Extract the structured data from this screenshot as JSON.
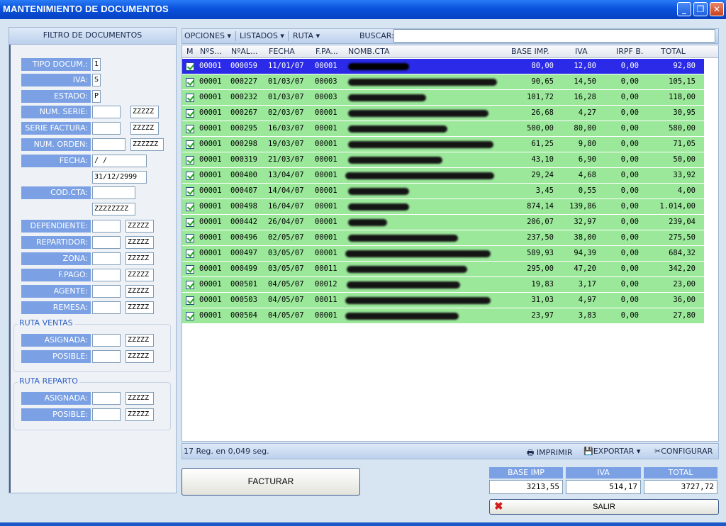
{
  "window": {
    "title": "MANTENIMIENTO DE DOCUMENTOS",
    "controls": {
      "minimize": "_",
      "maximize": "❐",
      "close": "✕"
    }
  },
  "filter": {
    "header": "FILTRO DE DOCUMENTOS",
    "fields": {
      "tipo_docum": {
        "label": "TIPO DOCUM.:",
        "value": "1"
      },
      "iva": {
        "label": "IVA:",
        "value": "S"
      },
      "estado": {
        "label": "ESTADO:",
        "value": "P"
      },
      "num_serie": {
        "label": "NUM. SERIE:",
        "from": "",
        "to": "ZZZZZ"
      },
      "serie_factura": {
        "label": "SERIE FACTURA:",
        "from": "",
        "to": "ZZZZZ"
      },
      "num_orden": {
        "label": "NUM. ORDEN:",
        "from": "",
        "to": "ZZZZZZ"
      },
      "fecha": {
        "label": "FECHA:",
        "from": " /  /",
        "to": "31/12/2999"
      },
      "cod_cta": {
        "label": "COD.CTA:",
        "from": "",
        "to": "ZZZZZZZZ"
      },
      "dependiente": {
        "label": "DEPENDIENTE:",
        "from": "",
        "to": "ZZZZZ"
      },
      "repartidor": {
        "label": "REPARTIDOR:",
        "from": "",
        "to": "ZZZZZ"
      },
      "zona": {
        "label": "ZONA:",
        "from": "",
        "to": "ZZZZZ"
      },
      "fpago": {
        "label": "F.PAGO:",
        "from": "",
        "to": "ZZZZZ"
      },
      "agente": {
        "label": "AGENTE:",
        "from": "",
        "to": "ZZZZZ"
      },
      "remesa": {
        "label": "REMESA:",
        "from": "",
        "to": "ZZZZZ"
      }
    },
    "ruta_ventas": {
      "title": "RUTA VENTAS",
      "asignada": {
        "label": "ASIGNADA:",
        "from": "",
        "to": "ZZZZZ"
      },
      "posible": {
        "label": "POSIBLE:",
        "from": "",
        "to": "ZZZZZ"
      }
    },
    "ruta_reparto": {
      "title": "RUTA REPARTO",
      "asignada": {
        "label": "ASIGNADA:",
        "from": "",
        "to": "ZZZZZ"
      },
      "posible": {
        "label": "POSIBLE:",
        "from": "",
        "to": "ZZZZZ"
      }
    }
  },
  "toolbar": {
    "opciones": "OPCIONES",
    "listados": "LISTADOS",
    "ruta": "RUTA",
    "buscar_label": "BUSCAR:",
    "buscar_value": "",
    "dropdown_arrow": "▾"
  },
  "grid": {
    "columns": [
      "M",
      "NºS...",
      "NºAL...",
      "FECHA",
      "F.PA...",
      "NOMB.CTA",
      "BASE IMP.",
      "IVA",
      "IRPF B.",
      "TOTAL"
    ],
    "rows": [
      {
        "serie": "00001",
        "num": "000059",
        "fecha": "11/01/07",
        "fpago": "00001",
        "base": "80,00",
        "iva": "12,80",
        "irpf": "0,00",
        "total": "92,80"
      },
      {
        "serie": "00001",
        "num": "000227",
        "fecha": "01/03/07",
        "fpago": "00003",
        "base": "90,65",
        "iva": "14,50",
        "irpf": "0,00",
        "total": "105,15"
      },
      {
        "serie": "00001",
        "num": "000232",
        "fecha": "01/03/07",
        "fpago": "00003",
        "base": "101,72",
        "iva": "16,28",
        "irpf": "0,00",
        "total": "118,00"
      },
      {
        "serie": "00001",
        "num": "000267",
        "fecha": "02/03/07",
        "fpago": "00001",
        "base": "26,68",
        "iva": "4,27",
        "irpf": "0,00",
        "total": "30,95"
      },
      {
        "serie": "00001",
        "num": "000295",
        "fecha": "16/03/07",
        "fpago": "00001",
        "base": "500,00",
        "iva": "80,00",
        "irpf": "0,00",
        "total": "580,00"
      },
      {
        "serie": "00001",
        "num": "000298",
        "fecha": "19/03/07",
        "fpago": "00001",
        "base": "61,25",
        "iva": "9,80",
        "irpf": "0,00",
        "total": "71,05"
      },
      {
        "serie": "00001",
        "num": "000319",
        "fecha": "21/03/07",
        "fpago": "00001",
        "base": "43,10",
        "iva": "6,90",
        "irpf": "0,00",
        "total": "50,00"
      },
      {
        "serie": "00001",
        "num": "000400",
        "fecha": "13/04/07",
        "fpago": "00001",
        "base": "29,24",
        "iva": "4,68",
        "irpf": "0,00",
        "total": "33,92"
      },
      {
        "serie": "00001",
        "num": "000407",
        "fecha": "14/04/07",
        "fpago": "00001",
        "base": "3,45",
        "iva": "0,55",
        "irpf": "0,00",
        "total": "4,00"
      },
      {
        "serie": "00001",
        "num": "000498",
        "fecha": "16/04/07",
        "fpago": "00001",
        "base": "874,14",
        "iva": "139,86",
        "irpf": "0,00",
        "total": "1.014,00"
      },
      {
        "serie": "00001",
        "num": "000442",
        "fecha": "26/04/07",
        "fpago": "00001",
        "base": "206,07",
        "iva": "32,97",
        "irpf": "0,00",
        "total": "239,04"
      },
      {
        "serie": "00001",
        "num": "000496",
        "fecha": "02/05/07",
        "fpago": "00001",
        "base": "237,50",
        "iva": "38,00",
        "irpf": "0,00",
        "total": "275,50"
      },
      {
        "serie": "00001",
        "num": "000497",
        "fecha": "03/05/07",
        "fpago": "00001",
        "base": "589,93",
        "iva": "94,39",
        "irpf": "0,00",
        "total": "684,32"
      },
      {
        "serie": "00001",
        "num": "000499",
        "fecha": "03/05/07",
        "fpago": "00011",
        "base": "295,00",
        "iva": "47,20",
        "irpf": "0,00",
        "total": "342,20"
      },
      {
        "serie": "00001",
        "num": "000501",
        "fecha": "04/05/07",
        "fpago": "00012",
        "base": "19,83",
        "iva": "3,17",
        "irpf": "0,00",
        "total": "23,00"
      },
      {
        "serie": "00001",
        "num": "000503",
        "fecha": "04/05/07",
        "fpago": "00011",
        "base": "31,03",
        "iva": "4,97",
        "irpf": "0,00",
        "total": "36,00"
      },
      {
        "serie": "00001",
        "num": "000504",
        "fecha": "04/05/07",
        "fpago": "00001",
        "base": "23,97",
        "iva": "3,83",
        "irpf": "0,00",
        "total": "27,80"
      }
    ],
    "selected_index": 0,
    "row_color": "#9be89b",
    "selected_color": "#2a2ae8"
  },
  "footer": {
    "count_text": "17 Reg. en 0,049 seg.",
    "imprimir": "IMPRIMIR",
    "exportar": "EXPORTAR",
    "configurar": "CONFIGURAR",
    "print_icon": "🖶",
    "save_icon": "💾",
    "tools_icon": "✂",
    "dropdown_arrow": "▾"
  },
  "actions": {
    "facturar": "FACTURAR",
    "salir": "SALIR",
    "salir_icon": "✖"
  },
  "totals": {
    "base_label": "BASE IMP",
    "base_value": "3213,55",
    "iva_label": "IVA",
    "iva_value": "514,17",
    "total_label": "TOTAL",
    "total_value": "3727,72"
  }
}
